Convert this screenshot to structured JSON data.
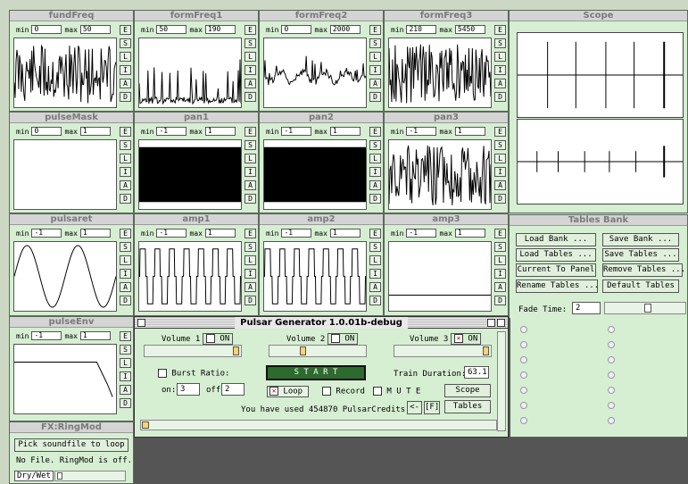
{
  "panels": [
    {
      "title": "fundFreq",
      "min": "0",
      "max": "50"
    },
    {
      "title": "formFreq1",
      "min": "50",
      "max": "190"
    },
    {
      "title": "formFreq2",
      "min": "0",
      "max": "2000"
    },
    {
      "title": "formFreq3",
      "min": "210",
      "max": "5450"
    },
    {
      "title": "pulseMask",
      "min": "0",
      "max": "1"
    },
    {
      "title": "pan1",
      "min": "-1",
      "max": "1"
    },
    {
      "title": "pan2",
      "min": "-1",
      "max": "1"
    },
    {
      "title": "pan3",
      "min": "-1",
      "max": "1"
    },
    {
      "title": "pulsaret",
      "min": "-1",
      "max": "1"
    },
    {
      "title": "amp1",
      "min": "-1",
      "max": "1"
    },
    {
      "title": "amp2",
      "min": "-1",
      "max": "1"
    },
    {
      "title": "amp3",
      "min": "-1",
      "max": "1"
    },
    {
      "title": "pulseEnv",
      "min": "-1",
      "max": "1"
    }
  ],
  "labels": {
    "min": "min",
    "max": "max"
  },
  "side_buttons": [
    "E",
    "S",
    "L",
    "I",
    "A",
    "D"
  ],
  "scope": {
    "title": "Scope"
  },
  "tables_bank": {
    "title": "Tables Bank",
    "buttons": [
      "Load Bank ...",
      "Save Bank ...",
      "Load Tables ...",
      "Save Tables ...",
      "Current To Panel",
      "Remove Tables ...",
      "Rename Tables ...",
      "Default Tables"
    ],
    "fade_label": "Fade Time:",
    "fade_value": "2"
  },
  "fx": {
    "title": "FX:RingMod",
    "pick_button": "Pick soundfile to loop",
    "status": "No File. RingMod is off.",
    "drywet": "Dry/Wet"
  },
  "dialog": {
    "title": "Pulsar Generator 1.0.01b-debug",
    "volume1": "Volume 1",
    "volume2": "Volume 2",
    "volume3": "Volume 3",
    "on": "ON",
    "burst_ratio": "Burst Ratio:",
    "on_label": "on:",
    "on_value": "3",
    "off_label": "off:",
    "off_value": "2",
    "start": "S T A R T",
    "train_duration": "Train Duration:",
    "train_value": "63.1",
    "loop": "Loop",
    "record": "Record",
    "mute": "M U T E",
    "scope_btn": "Scope",
    "tables_btn": "Tables",
    "credits": "You have used 454870 PulsarCredits.",
    "back_btn": "<-",
    "f_btn": "[F]"
  }
}
